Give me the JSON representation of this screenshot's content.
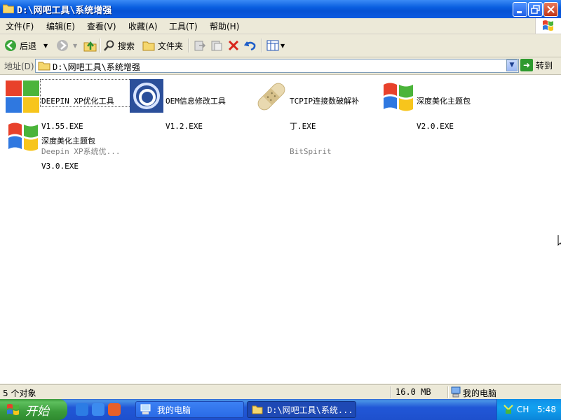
{
  "window": {
    "title": "D:\\网吧工具\\系统增强"
  },
  "menu": [
    "文件(F)",
    "编辑(E)",
    "查看(V)",
    "收藏(A)",
    "工具(T)",
    "帮助(H)"
  ],
  "toolbar": {
    "back_label": "后退",
    "search_label": "搜索",
    "folders_label": "文件夹"
  },
  "address": {
    "label": "地址(D)",
    "value": "D:\\网吧工具\\系统增强",
    "go_label": "转到"
  },
  "files": [
    {
      "name": "DEEPIN XP优化工具",
      "detail": "V1.55.EXE",
      "sub": "Deepin XP系统优...",
      "icon": "windows-flag-icon",
      "selected": true
    },
    {
      "name": "OEM信息修改工具",
      "detail": "V1.2.EXE",
      "sub": "",
      "icon": "swirl-icon"
    },
    {
      "name": "TCPIP连接数破解补",
      "name2": "丁.EXE",
      "sub": "BitSpirit",
      "icon": "bandage-icon"
    },
    {
      "name": "深度美化主题包",
      "detail": "V2.0.EXE",
      "sub": "",
      "icon": "windows-flag-icon"
    },
    {
      "name": "深度美化主题包",
      "detail": "V3.0.EXE",
      "sub": "",
      "icon": "windows-flag-icon"
    }
  ],
  "status": {
    "objects": "5 个对象",
    "size": "16.0 MB",
    "location": "我的电脑"
  },
  "taskbar": {
    "start_label": "开始",
    "tasks": [
      {
        "label": "我的电脑",
        "active": false
      },
      {
        "label": "D:\\网吧工具\\系统...",
        "active": true
      }
    ],
    "lang": "CH",
    "time": "5:48"
  },
  "colors": {
    "title_blue": "#0a5fe0",
    "taskbar_blue": "#2157d7",
    "start_green": "#3a9b3a",
    "tray_blue": "#0f8fe8"
  }
}
